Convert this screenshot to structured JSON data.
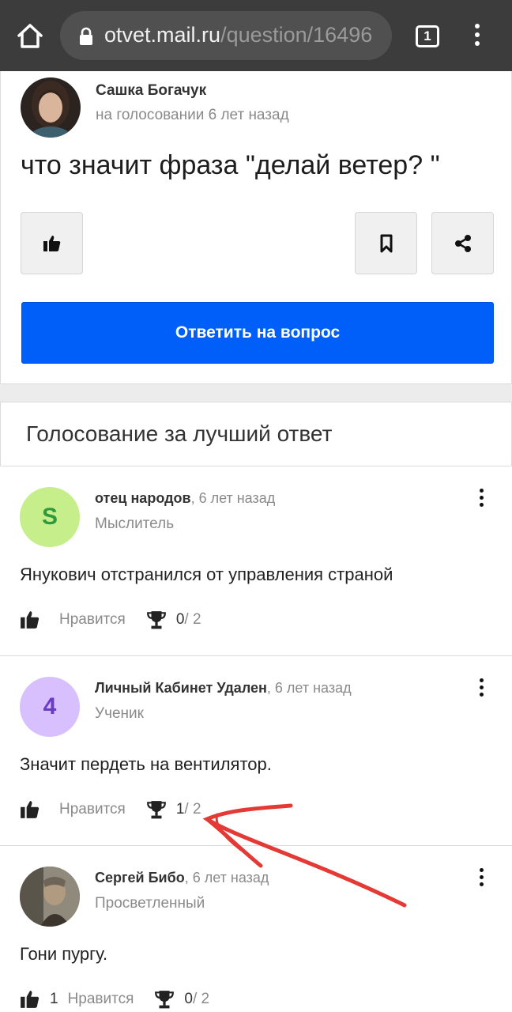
{
  "browser": {
    "url_host": "otvet.mail.ru",
    "url_path": "/question/16496",
    "tab_count": "1"
  },
  "question": {
    "author": "Сашка Богачук",
    "meta": "на голосовании 6 лет назад",
    "title": "что значит фраза \"делай ветер? \"",
    "answer_button": "Ответить на вопрос"
  },
  "vote": {
    "title": "Голосование за лучший ответ"
  },
  "answers": [
    {
      "initial": "S",
      "name": "отец народов",
      "time": ", 6 лет назад",
      "rank": "Мыслитель",
      "text": "Янукович отстранился от управления страной",
      "like_label": "Нравится",
      "like_count": "",
      "votes_cur": "0",
      "votes_total": " / 2",
      "avatar_bg": "#c6ee8a",
      "avatar_fg": "#2e9a3c"
    },
    {
      "initial": "4",
      "name": "Личный Кабинет Удален",
      "time": ", 6 лет назад",
      "rank": "Ученик",
      "text": "Значит пердеть на вентилятор.",
      "like_label": "Нравится",
      "like_count": "",
      "votes_cur": "1",
      "votes_total": " / 2",
      "avatar_bg": "#d8c0ff",
      "avatar_fg": "#6a3cc6"
    },
    {
      "initial": "",
      "name": "Сергей Бибо",
      "time": ", 6 лет назад",
      "rank": "Просветленный",
      "text": "Гони пургу.",
      "like_label": "Нравится",
      "like_count": "1",
      "votes_cur": "0",
      "votes_total": " / 2",
      "avatar_bg": "#6b6355",
      "avatar_fg": "#ffffff"
    }
  ],
  "colors": {
    "primary": "#005ff9",
    "annotation": "#e53935"
  }
}
